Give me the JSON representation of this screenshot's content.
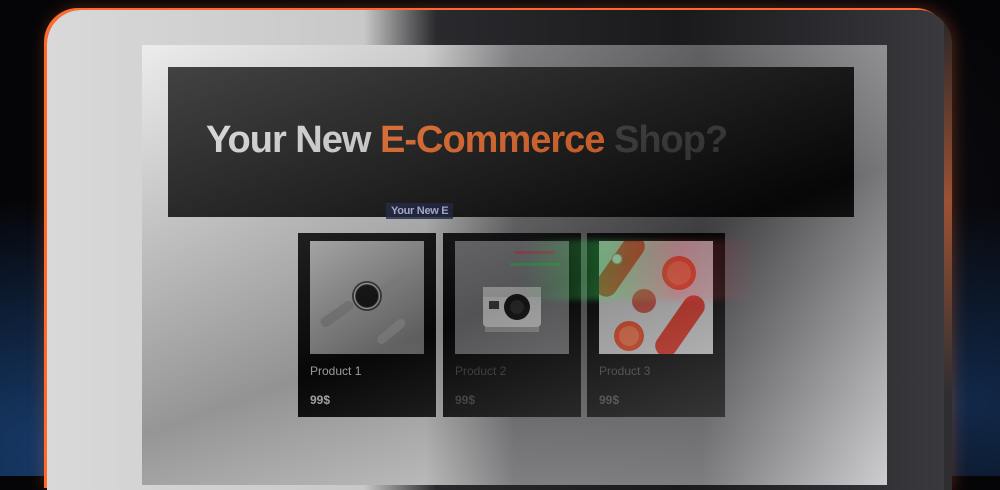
{
  "hero": {
    "title_part1": "Your New ",
    "title_accent": "E-Commerce",
    "title_part2": " Shop?",
    "subtitle": "Your New E"
  },
  "products": [
    {
      "name": "Product 1",
      "price": "99$",
      "image": "smartwatch-icon"
    },
    {
      "name": "Product 2",
      "price": "99$",
      "image": "instant-camera-icon"
    },
    {
      "name": "Product 3",
      "price": "99$",
      "image": "grapefruit-icon"
    }
  ],
  "colors": {
    "accent": "#ff6a1f",
    "card_bg": "#0b0b0c",
    "hero_bg": "#0a0a0b",
    "device_edge": "#ff6a2a"
  }
}
